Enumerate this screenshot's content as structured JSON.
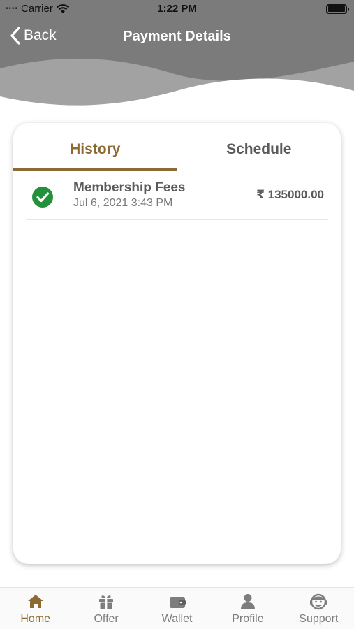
{
  "status_bar": {
    "carrier": "Carrier",
    "time": "1:22 PM"
  },
  "nav": {
    "back_label": "Back",
    "title": "Payment Details"
  },
  "tabs": [
    {
      "label": "History",
      "active": true
    },
    {
      "label": "Schedule",
      "active": false
    }
  ],
  "transactions": [
    {
      "title": "Membership Fees",
      "date": "Jul 6, 2021 3:43 PM",
      "amount": "₹ 135000.00",
      "status": "success"
    }
  ],
  "bottom_nav": [
    {
      "label": "Home",
      "icon": "home-icon",
      "active": true
    },
    {
      "label": "Offer",
      "icon": "gift-icon",
      "active": false
    },
    {
      "label": "Wallet",
      "icon": "wallet-icon",
      "active": false
    },
    {
      "label": "Profile",
      "icon": "profile-icon",
      "active": false
    },
    {
      "label": "Support",
      "icon": "support-icon",
      "active": false
    }
  ],
  "colors": {
    "accent": "#8b6a34",
    "header": "#7b7b7b",
    "success": "#23913b",
    "text": "#5a5a5a"
  }
}
